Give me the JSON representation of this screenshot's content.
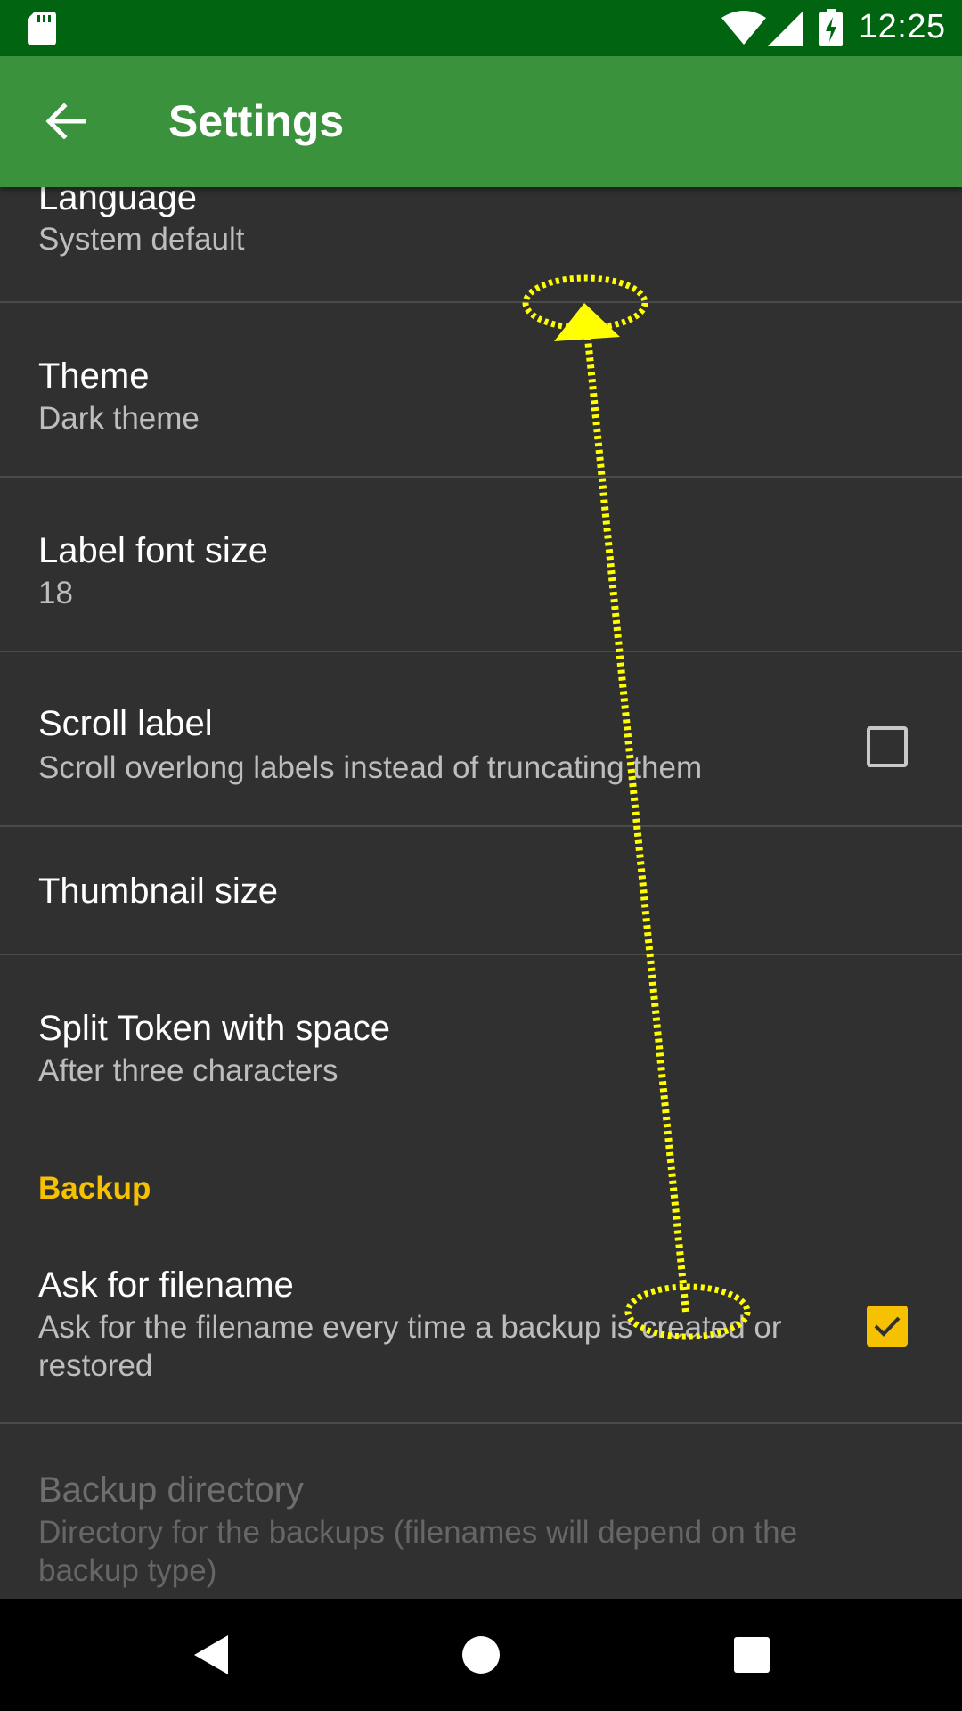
{
  "status_bar": {
    "time": "12:25",
    "icons": [
      "sd-card-icon",
      "wifi-icon",
      "signal-icon",
      "battery-charging-icon"
    ]
  },
  "app_bar": {
    "title": "Settings",
    "back_icon": "arrow-back-icon"
  },
  "preferences": {
    "language": {
      "title": "Language",
      "summary": "System default"
    },
    "theme": {
      "title": "Theme",
      "summary": "Dark theme"
    },
    "label_font_size": {
      "title": "Label font size",
      "summary": "18"
    },
    "scroll_label": {
      "title": "Scroll label",
      "summary": "Scroll overlong labels instead of truncating them",
      "checked": false
    },
    "thumbnail_size": {
      "title": "Thumbnail size"
    },
    "split_token": {
      "title": "Split Token with space",
      "summary": "After three characters"
    },
    "backup_category": {
      "title": "Backup"
    },
    "ask_for_filename": {
      "title": "Ask for filename",
      "summary": "Ask for the filename every time a backup is created or restored",
      "checked": true
    },
    "backup_directory": {
      "title": "Backup directory",
      "summary": "Directory for the backups (filenames will depend on the backup type)",
      "enabled": false
    }
  },
  "nav_bar": {
    "icons": [
      "back-triangle-icon",
      "home-circle-icon",
      "recents-square-icon"
    ]
  },
  "colors": {
    "status_bar": "#006411",
    "app_bar": "#3a923c",
    "background": "#303030",
    "accent": "#f5c100",
    "gesture_overlay": "#ffff00"
  }
}
